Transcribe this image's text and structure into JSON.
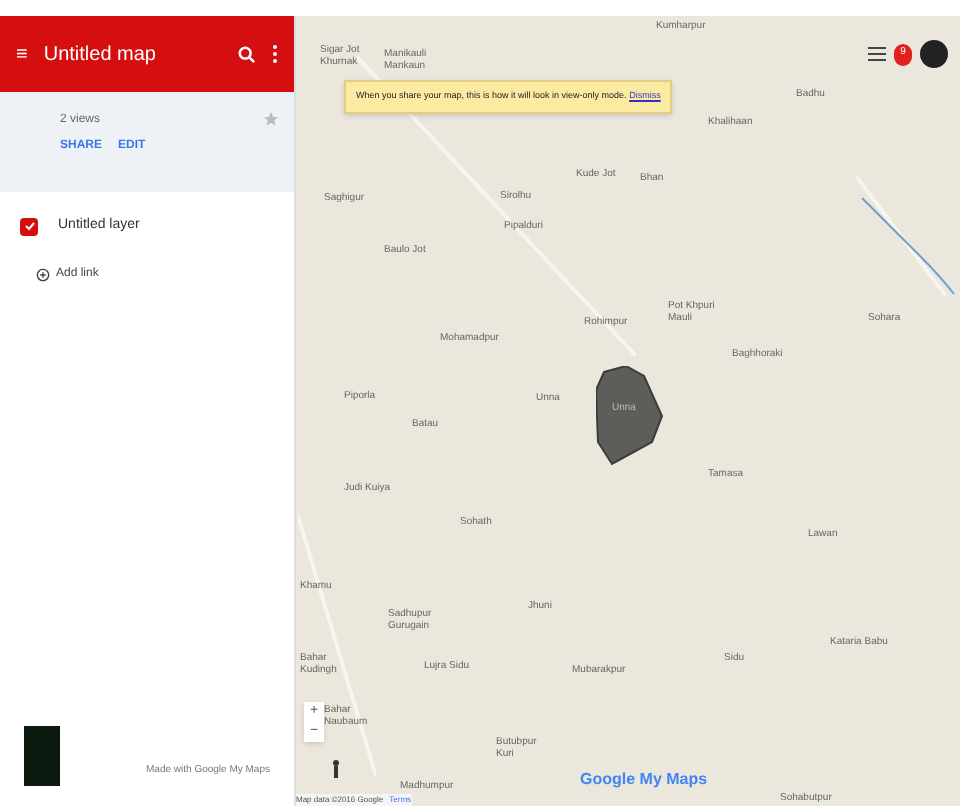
{
  "header": {
    "menu": "≡",
    "title": "Untitled map"
  },
  "info": {
    "views": "2 views",
    "actions": [
      "SHARE",
      "EDIT"
    ]
  },
  "layers": [
    {
      "name": "Untitled layer",
      "checked": true,
      "link": "Add link"
    }
  ],
  "footer": {
    "credit": "Made with Google My Maps"
  },
  "notice": {
    "text": "When you share your map, this is how it will look in view-only mode.",
    "link": "Dismiss"
  },
  "map": {
    "labels": [
      "Kumharpur",
      "Sigar Jot Khurnak",
      "Manikauli Mankaun",
      "Badhu",
      "Khalihaan",
      "Kude Jot",
      "Bhan",
      "Saghigur",
      "Sirolhu",
      "Pipalduri",
      "Baulo Jot",
      "Rohimpur",
      "Pot Khpuri Mauli",
      "Sohara",
      "Mohamadpur",
      "Baghhoraki",
      "Piporla",
      "Unna",
      "Batau",
      "Tamasa",
      "Judi Kuiya",
      "Sohath",
      "Lawan",
      "Khamu",
      "Sadhupur Gurugain",
      "Jhuni",
      "Lujra Sidu",
      "Mubarakpur",
      "Sidu",
      "Kataria Babu",
      "Bahar Kudingh",
      "Bahar Naubaum",
      "Butubpur Kuri",
      "Madhumpur",
      "Sohabutpur"
    ],
    "polygon_label": "Unna",
    "notification_count": "9",
    "zoom_in": "+",
    "zoom_out": "−",
    "logo": "Google My Maps",
    "attribution": "Map data ©2016 Google",
    "terms": "Terms"
  }
}
